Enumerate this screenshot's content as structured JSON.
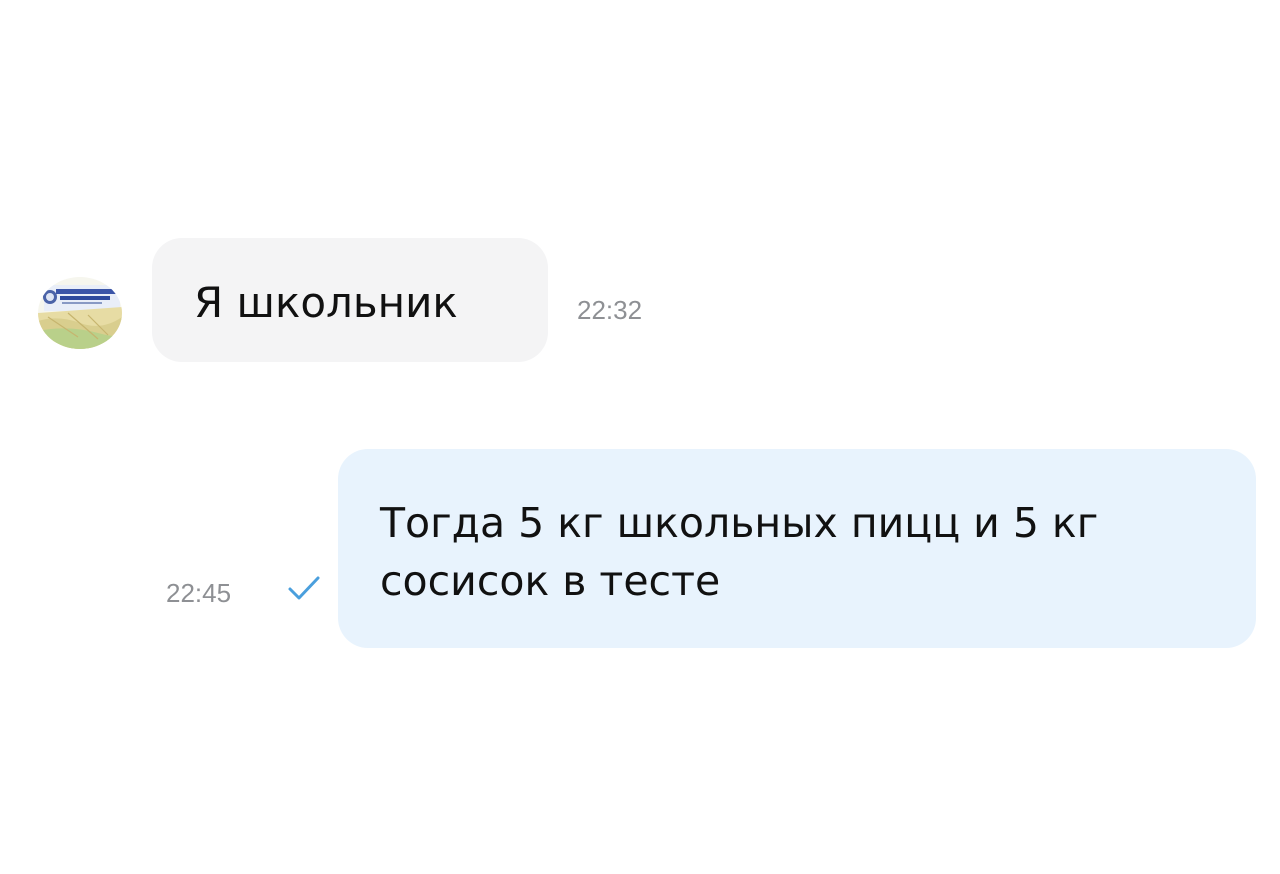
{
  "messages": [
    {
      "direction": "incoming",
      "text": "Я школьник",
      "time": "22:32"
    },
    {
      "direction": "outgoing",
      "text": "Тогда 5 кг школьных пицц и 5 кг сосисок в тесте",
      "time": "22:45",
      "status_icon": "single-check-icon",
      "status_color": "#4a9fdd"
    }
  ],
  "colors": {
    "incoming_bubble": "#f4f4f5",
    "outgoing_bubble": "#e8f3fd",
    "time_text": "#8e9094"
  }
}
